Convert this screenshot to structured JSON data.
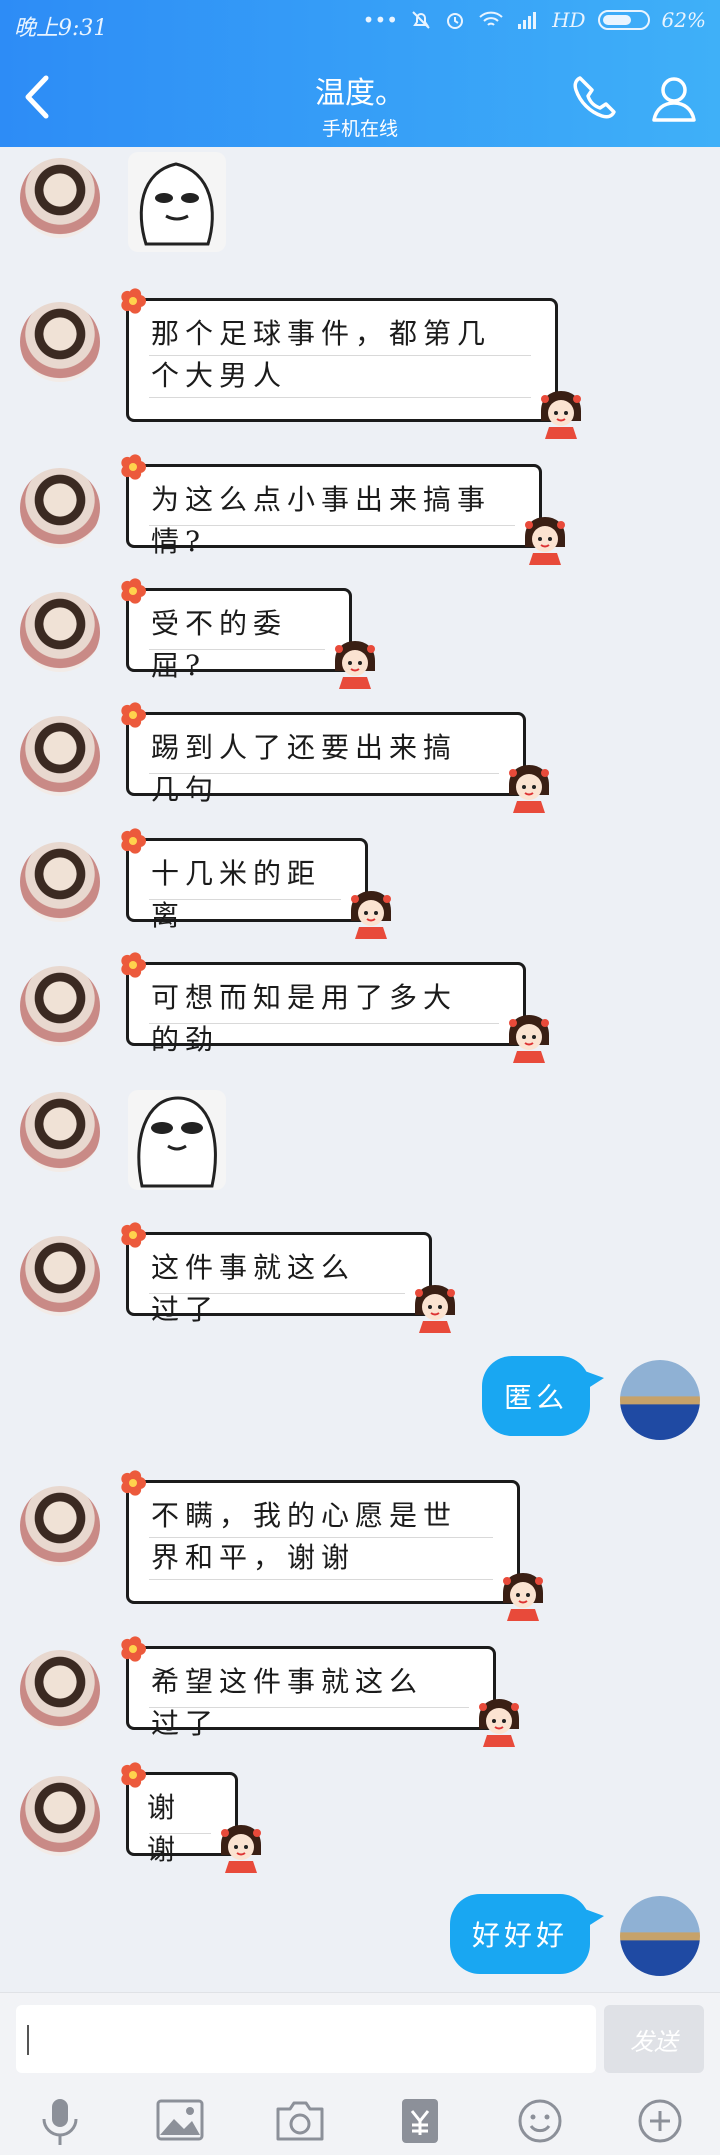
{
  "status_bar": {
    "time": "晚上9:31",
    "network": "HD",
    "battery": "62%"
  },
  "header": {
    "title": "温度。",
    "subtitle": "手机在线"
  },
  "messages": [
    {
      "text": "那个足球事件，都第几个大男人"
    },
    {
      "text": "为这么点小事出来搞事情?"
    },
    {
      "text": "受不的委屈?"
    },
    {
      "text": "踢到人了还要出来搞几句"
    },
    {
      "text": "十几米的距离"
    },
    {
      "text": "可想而知是用了多大的劲"
    },
    {
      "text": "这件事就这么过了"
    },
    {
      "text": "匿么"
    },
    {
      "text": "不瞒，我的心愿是世界和平，谢谢"
    },
    {
      "text": "希望这件事就这么过了"
    },
    {
      "text": "谢谢"
    },
    {
      "text": "好好好"
    }
  ],
  "input": {
    "placeholder": "",
    "send_label": "发送"
  },
  "colors": {
    "header_start": "#2d8cf6",
    "header_end": "#3fb0f8",
    "outgoing": "#19a7f2",
    "background": "#edf0f5"
  },
  "toolbar": [
    "mic-icon",
    "image-icon",
    "camera-icon",
    "red-packet-icon",
    "emoji-icon",
    "plus-icon"
  ]
}
